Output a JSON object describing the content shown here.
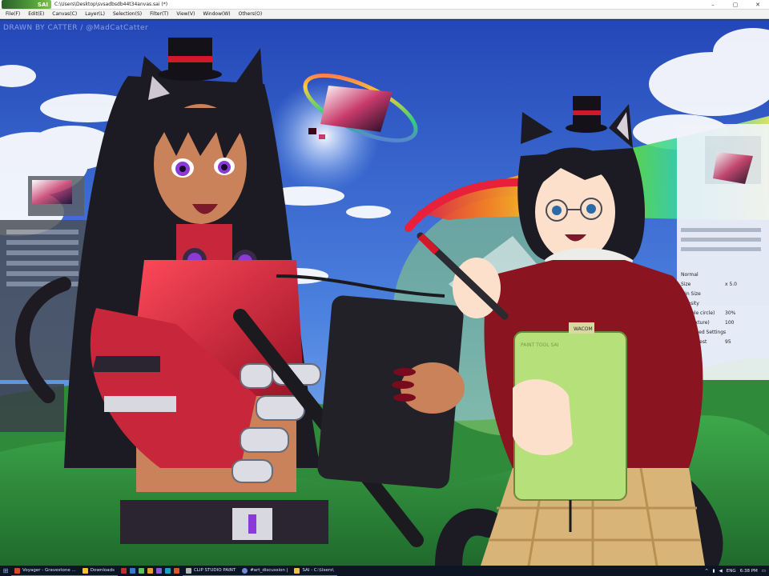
{
  "window": {
    "logo_text": "SAI",
    "title": "C:\\Users\\Desktop\\svsadbsdb44t34anvas.sai (*)",
    "controls": {
      "minimize": "–",
      "maximize": "▢",
      "close": "✕"
    }
  },
  "menu": [
    {
      "label": "File(F)"
    },
    {
      "label": "Edit(E)"
    },
    {
      "label": "Canvas(C)"
    },
    {
      "label": "Layer(L)"
    },
    {
      "label": "Selection(S)"
    },
    {
      "label": "Filter(T)"
    },
    {
      "label": "View(V)"
    },
    {
      "label": "Window(W)"
    },
    {
      "label": "Others(O)"
    }
  ],
  "canvas": {
    "watermark": "DRAWN BY CATTER / @MadCatCatter",
    "tablet_brand": "WACOM",
    "tablet_text": "PAINT TOOL SAI"
  },
  "panel_right": {
    "items": [
      "Normal",
      "Size",
      "Min Size",
      "Density",
      "(simple circle)",
      "(no texture)",
      "Advanced Settings",
      "Smoothest"
    ],
    "values": [
      "x 5.0",
      "30%",
      "100",
      "95"
    ]
  },
  "taskbar": {
    "apps": [
      {
        "label": "Voyager - Gravestone ...",
        "icon_color": "#d24a2a"
      },
      {
        "label": "Downloads",
        "icon_color": "#f1c232"
      },
      {
        "label": "CLIP STUDIO PAINT",
        "icon_color": "#b7b7b7"
      },
      {
        "label": "#art_discussion |",
        "icon_color": "#7289da"
      },
      {
        "label": "SAI - C:\\Users\\",
        "icon_color": "#e8c34a"
      }
    ],
    "tray_lang": "ENG",
    "clock": "6:38 PM"
  },
  "colors": {
    "sky_top": "#2d55c8",
    "sky_bottom": "#7fb0f0",
    "grass": "#2f8a3a",
    "accent_red": "#c8263a",
    "tablet_green": "#b6e07a"
  }
}
